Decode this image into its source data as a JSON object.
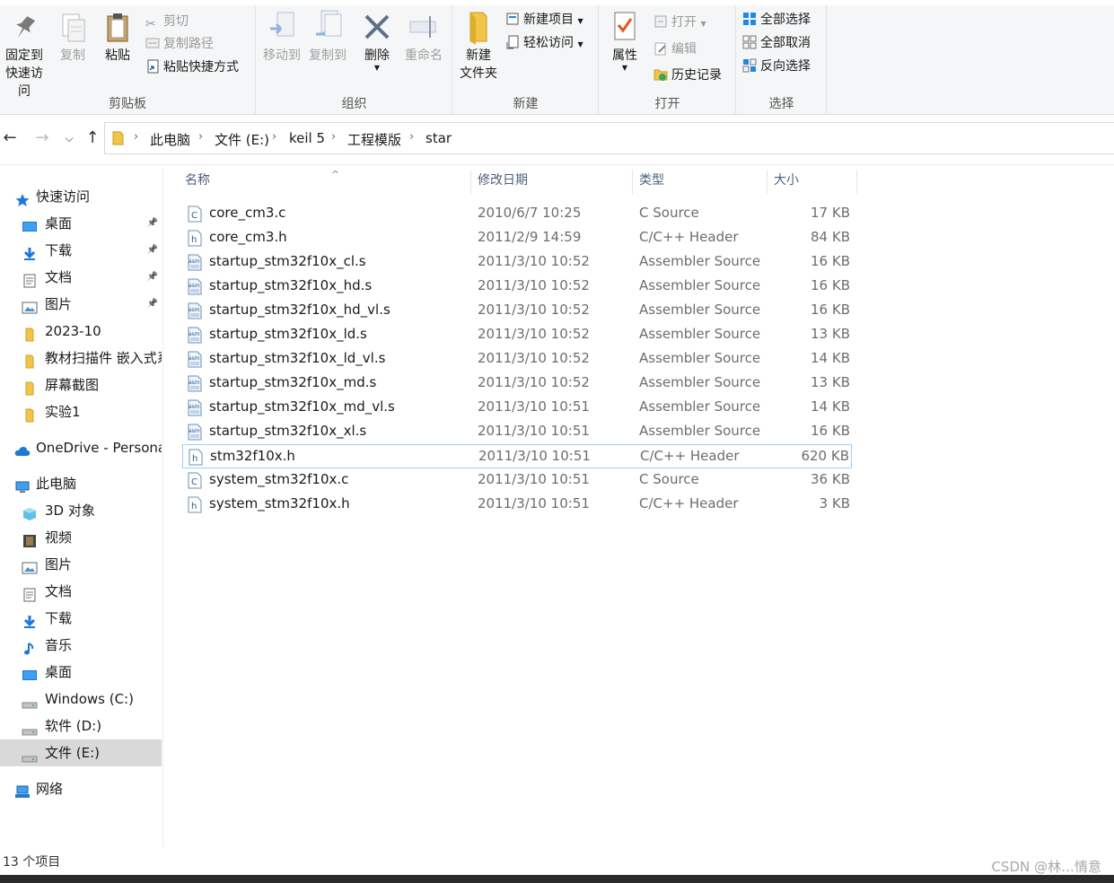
{
  "ribbon": {
    "clipboard": {
      "pin_label_1": "固定到",
      "pin_label_2": "快速访问",
      "copy": "复制",
      "paste": "粘贴",
      "cut": "剪切",
      "copy_path": "复制路径",
      "paste_shortcut": "粘贴快捷方式",
      "group": "剪贴板"
    },
    "organize": {
      "move_to": "移动到",
      "copy_to": "复制到",
      "delete": "删除",
      "rename": "重命名",
      "group": "组织"
    },
    "new": {
      "new_folder_1": "新建",
      "new_folder_2": "文件夹",
      "new_item": "新建项目",
      "easy_access": "轻松访问",
      "group": "新建"
    },
    "open": {
      "properties": "属性",
      "open": "打开",
      "edit": "编辑",
      "history": "历史记录",
      "group": "打开"
    },
    "select": {
      "select_all": "全部选择",
      "select_none": "全部取消",
      "invert": "反向选择",
      "group": "选择"
    }
  },
  "address": {
    "crumbs": [
      "此电脑",
      "文件 (E:)",
      "keil 5",
      "工程模版",
      "star"
    ]
  },
  "sidebar": {
    "items": [
      {
        "label": "快速访问",
        "icon": "star-icon",
        "level": 0
      },
      {
        "label": "桌面",
        "icon": "desktop-icon",
        "level": 1,
        "pinned": true
      },
      {
        "label": "下载",
        "icon": "download-icon",
        "level": 1,
        "pinned": true
      },
      {
        "label": "文档",
        "icon": "document-icon",
        "level": 1,
        "pinned": true
      },
      {
        "label": "图片",
        "icon": "pictures-icon",
        "level": 1,
        "pinned": true
      },
      {
        "label": "2023-10",
        "icon": "folder-icon",
        "level": 1
      },
      {
        "label": "教材扫描件 嵌入式系",
        "icon": "folder-icon",
        "level": 1
      },
      {
        "label": "屏幕截图",
        "icon": "folder-icon",
        "level": 1
      },
      {
        "label": "实验1",
        "icon": "folder-icon",
        "level": 1
      },
      {
        "label": "OneDrive - Persona",
        "icon": "cloud-icon",
        "level": 0
      },
      {
        "label": "此电脑",
        "icon": "computer-icon",
        "level": 0
      },
      {
        "label": "3D 对象",
        "icon": "cube-icon",
        "level": 1
      },
      {
        "label": "视频",
        "icon": "video-icon",
        "level": 1
      },
      {
        "label": "图片",
        "icon": "pictures-icon",
        "level": 1
      },
      {
        "label": "文档",
        "icon": "document-icon",
        "level": 1
      },
      {
        "label": "下载",
        "icon": "download-icon",
        "level": 1
      },
      {
        "label": "音乐",
        "icon": "music-icon",
        "level": 1
      },
      {
        "label": "桌面",
        "icon": "desktop-icon",
        "level": 1
      },
      {
        "label": "Windows (C:)",
        "icon": "drive-icon",
        "level": 1
      },
      {
        "label": "软件 (D:)",
        "icon": "drive-icon",
        "level": 1
      },
      {
        "label": "文件 (E:)",
        "icon": "drive-icon",
        "level": 1,
        "selected": true
      },
      {
        "label": "网络",
        "icon": "network-icon",
        "level": 0
      }
    ]
  },
  "columns": {
    "name": "名称",
    "date": "修改日期",
    "type": "类型",
    "size": "大小"
  },
  "files": [
    {
      "name": "core_cm3.c",
      "date": "2010/6/7 10:25",
      "type": "C Source",
      "size": "17 KB",
      "icon": "c-file-icon"
    },
    {
      "name": "core_cm3.h",
      "date": "2011/2/9 14:59",
      "type": "C/C++ Header",
      "size": "84 KB",
      "icon": "h-file-icon"
    },
    {
      "name": "startup_stm32f10x_cl.s",
      "date": "2011/3/10 10:52",
      "type": "Assembler Source",
      "size": "16 KB",
      "icon": "asm-file-icon"
    },
    {
      "name": "startup_stm32f10x_hd.s",
      "date": "2011/3/10 10:52",
      "type": "Assembler Source",
      "size": "16 KB",
      "icon": "asm-file-icon"
    },
    {
      "name": "startup_stm32f10x_hd_vl.s",
      "date": "2011/3/10 10:52",
      "type": "Assembler Source",
      "size": "16 KB",
      "icon": "asm-file-icon"
    },
    {
      "name": "startup_stm32f10x_ld.s",
      "date": "2011/3/10 10:52",
      "type": "Assembler Source",
      "size": "13 KB",
      "icon": "asm-file-icon"
    },
    {
      "name": "startup_stm32f10x_ld_vl.s",
      "date": "2011/3/10 10:52",
      "type": "Assembler Source",
      "size": "14 KB",
      "icon": "asm-file-icon"
    },
    {
      "name": "startup_stm32f10x_md.s",
      "date": "2011/3/10 10:52",
      "type": "Assembler Source",
      "size": "13 KB",
      "icon": "asm-file-icon"
    },
    {
      "name": "startup_stm32f10x_md_vl.s",
      "date": "2011/3/10 10:51",
      "type": "Assembler Source",
      "size": "14 KB",
      "icon": "asm-file-icon"
    },
    {
      "name": "startup_stm32f10x_xl.s",
      "date": "2011/3/10 10:51",
      "type": "Assembler Source",
      "size": "16 KB",
      "icon": "asm-file-icon"
    },
    {
      "name": "stm32f10x.h",
      "date": "2011/3/10 10:51",
      "type": "C/C++ Header",
      "size": "620 KB",
      "icon": "h-file-icon",
      "focused": true
    },
    {
      "name": "system_stm32f10x.c",
      "date": "2011/3/10 10:51",
      "type": "C Source",
      "size": "36 KB",
      "icon": "c-file-icon"
    },
    {
      "name": "system_stm32f10x.h",
      "date": "2011/3/10 10:51",
      "type": "C/C++ Header",
      "size": "3 KB",
      "icon": "h-file-icon"
    }
  ],
  "status": {
    "count": "13 个项目",
    "watermark": "CSDN @林…情意"
  }
}
